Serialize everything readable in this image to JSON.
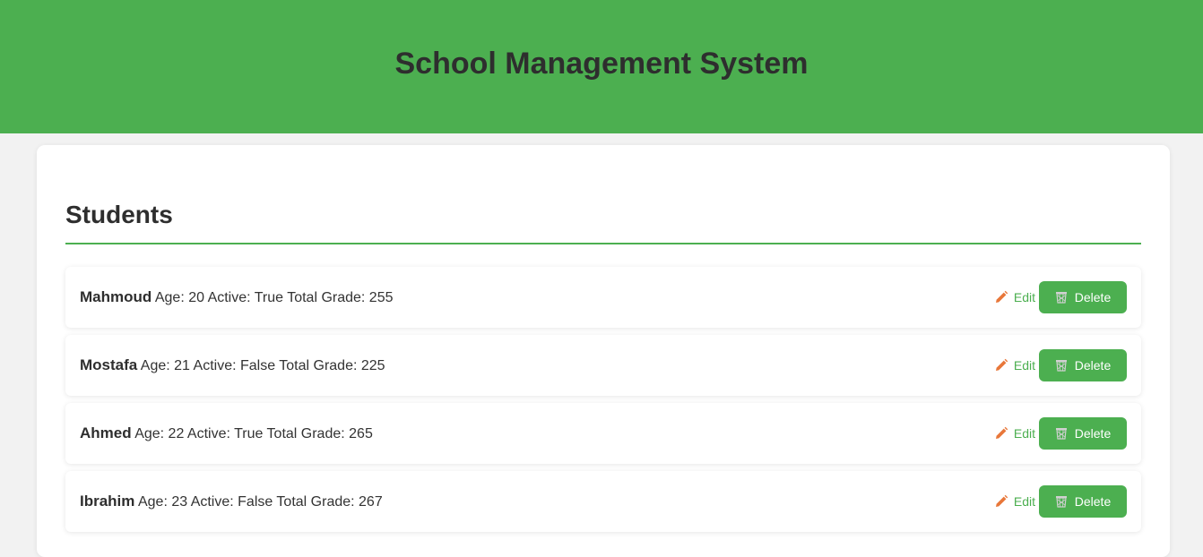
{
  "header": {
    "title": "School Management System"
  },
  "students_section": {
    "title": "Students",
    "edit_label": "Edit",
    "delete_label": "Delete",
    "students": [
      {
        "name": "Mahmoud",
        "details": "Age: 20 Active: True Total Grade: 255"
      },
      {
        "name": "Mostafa",
        "details": "Age: 21 Active: False Total Grade: 225"
      },
      {
        "name": "Ahmed",
        "details": "Age: 22 Active: True Total Grade: 265"
      },
      {
        "name": "Ibrahim",
        "details": "Age: 23 Active: False Total Grade: 267"
      }
    ]
  },
  "icons": {
    "edit": "pencil-icon",
    "delete": "wastebasket-icon"
  },
  "colors": {
    "accent": "#4caf50",
    "pencil": "#e8773a",
    "text": "#333333",
    "background": "#f2f2f2"
  }
}
